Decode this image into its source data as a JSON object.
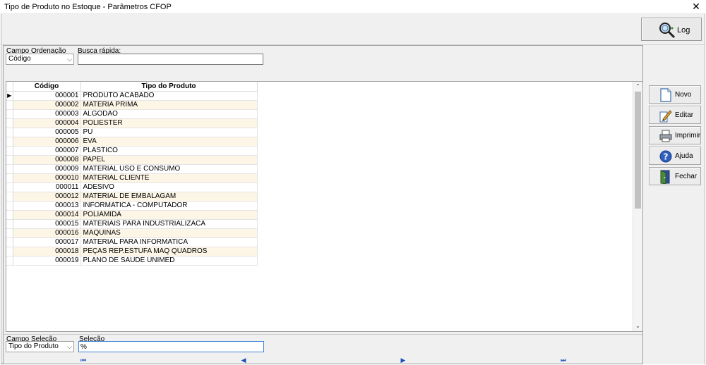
{
  "window": {
    "title": "Tipo de Produto no Estoque - Parâmetros CFOP",
    "close_glyph": "✕"
  },
  "toolbar": {
    "log_label": "Log",
    "log_icon": "magnifier-icon"
  },
  "filters": {
    "order_label": "Campo Ordenação",
    "order_value": "Código",
    "quick_search_label": "Busca rápida:",
    "quick_search_value": ""
  },
  "grid": {
    "columns": [
      "Código",
      "Tipo do Produto"
    ],
    "current_row_marker": "▶",
    "rows": [
      {
        "code": "000001",
        "name": "PRODUTO ACABADO"
      },
      {
        "code": "000002",
        "name": "MATERIA PRIMA"
      },
      {
        "code": "000003",
        "name": "ALGODAO"
      },
      {
        "code": "000004",
        "name": "POLIESTER"
      },
      {
        "code": "000005",
        "name": "PU"
      },
      {
        "code": "000006",
        "name": "EVA"
      },
      {
        "code": "000007",
        "name": "PLASTICO"
      },
      {
        "code": "000008",
        "name": "PAPEL"
      },
      {
        "code": "000009",
        "name": "MATERIAL USO E CONSUMO"
      },
      {
        "code": "000010",
        "name": "MATERIAL CLIENTE"
      },
      {
        "code": "000011",
        "name": "ADESIVO"
      },
      {
        "code": "000012",
        "name": "MATERIAL DE EMBALAGAM"
      },
      {
        "code": "000013",
        "name": "INFORMATICA - COMPUTADOR"
      },
      {
        "code": "000014",
        "name": "POLIAMIDA"
      },
      {
        "code": "000015",
        "name": "MATERIAIS PARA INDUSTRIALIZACA"
      },
      {
        "code": "000016",
        "name": "MAQUINAS"
      },
      {
        "code": "000017",
        "name": "MATERIAL PARA  INFORMATICA"
      },
      {
        "code": "000018",
        "name": "PEÇAS REP.ESTUFA MAQ QUADROS"
      },
      {
        "code": "000019",
        "name": "PLANO DE SAUDE UNIMED"
      }
    ]
  },
  "selection": {
    "field_label": "Campo Seleção",
    "field_value": "Tipo do Produto",
    "value_label": "Seleção",
    "value": "%"
  },
  "navigation": {
    "first": "⏮",
    "prev": "◀",
    "next": "▶",
    "last": "⏭"
  },
  "actions": [
    {
      "label": "Novo",
      "icon": "new-document-icon"
    },
    {
      "label": "Editar",
      "icon": "edit-pencil-icon"
    },
    {
      "label": "Imprimir",
      "icon": "printer-icon"
    },
    {
      "label": "Ajuda",
      "icon": "help-icon"
    },
    {
      "label": "Fechar",
      "icon": "exit-door-icon"
    }
  ],
  "colors": {
    "alt_row": "#fdf6e7",
    "nav_arrows": "#1a4fb5",
    "window_bg": "#f0f0f0"
  }
}
